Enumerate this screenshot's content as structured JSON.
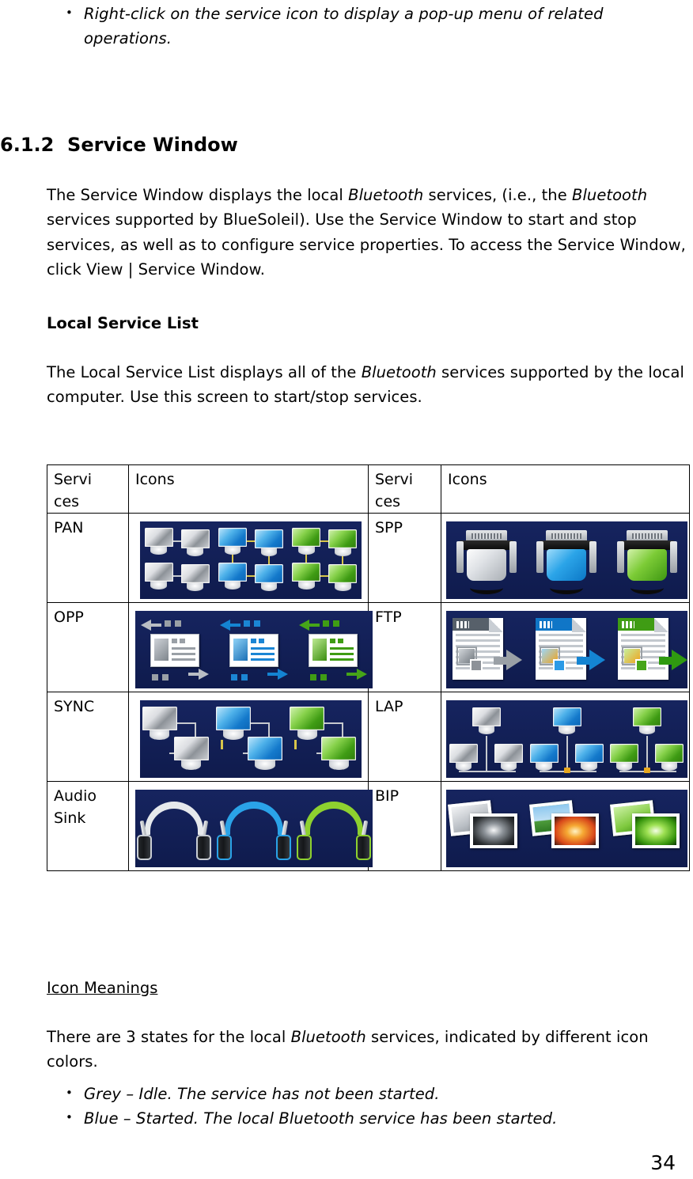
{
  "top_bullet": {
    "items": [
      "Right-click on the service icon to display a pop-up menu of related operations."
    ]
  },
  "heading": {
    "number": "6.1.2",
    "title": "Service Window",
    "full": "6.1.2  Service Window"
  },
  "paragraphs": {
    "intro_1": "The Service Window displays the local ",
    "intro_em_1": "Bluetooth",
    "intro_2": " services, (i.e., the ",
    "intro_em_2": "Bluetooth",
    "intro_3": " services supported by BlueSoleil). Use the Service Window to start and stop services, as well as to configure service properties. To access the Service Window, click View | Service Window.",
    "local_list_1": "The Local Service List displays all of the ",
    "local_list_em": "Bluetooth",
    "local_list_2": " services supported by the local computer. Use this screen to start/stop services.",
    "states_1": "There are 3 states for the local ",
    "states_em": "Bluetooth",
    "states_2": " services, indicated by different icon colors."
  },
  "subheads": {
    "local_service_list": "Local Service List",
    "icon_meanings": "Icon Meanings"
  },
  "table": {
    "headers": [
      "Services",
      "Icons",
      "Services",
      "Icons"
    ],
    "header_wrapped": [
      "Service",
      "s"
    ],
    "rows": [
      {
        "left_label": "PAN",
        "left_icon": "pan-network-icon",
        "right_label": "SPP",
        "right_icon": "spp-serial-port-icon"
      },
      {
        "left_label": "OPP",
        "left_icon": "opp-object-push-icon",
        "right_label": "FTP",
        "right_icon": "ftp-file-transfer-icon"
      },
      {
        "left_label": "SYNC",
        "left_icon": "sync-icon",
        "right_label": "LAP",
        "right_icon": "lap-lan-access-icon"
      },
      {
        "left_label": "Audio Sink",
        "left_icon": "audio-sink-headphones-icon",
        "right_label": "BIP",
        "right_icon": "bip-imaging-icon"
      }
    ]
  },
  "state_bullets": {
    "items": [
      "Grey – Idle. The service has not been started.",
      "Blue – Started. The local Bluetooth service has been started."
    ]
  },
  "page_number": "34",
  "colors": {
    "icon_background": "#16245f",
    "state_grey": "#c9ced4",
    "state_blue": "#1e8fd6",
    "state_green": "#4aa519",
    "page_background": "#ffffff",
    "text": "#000000",
    "table_border": "#000000"
  }
}
